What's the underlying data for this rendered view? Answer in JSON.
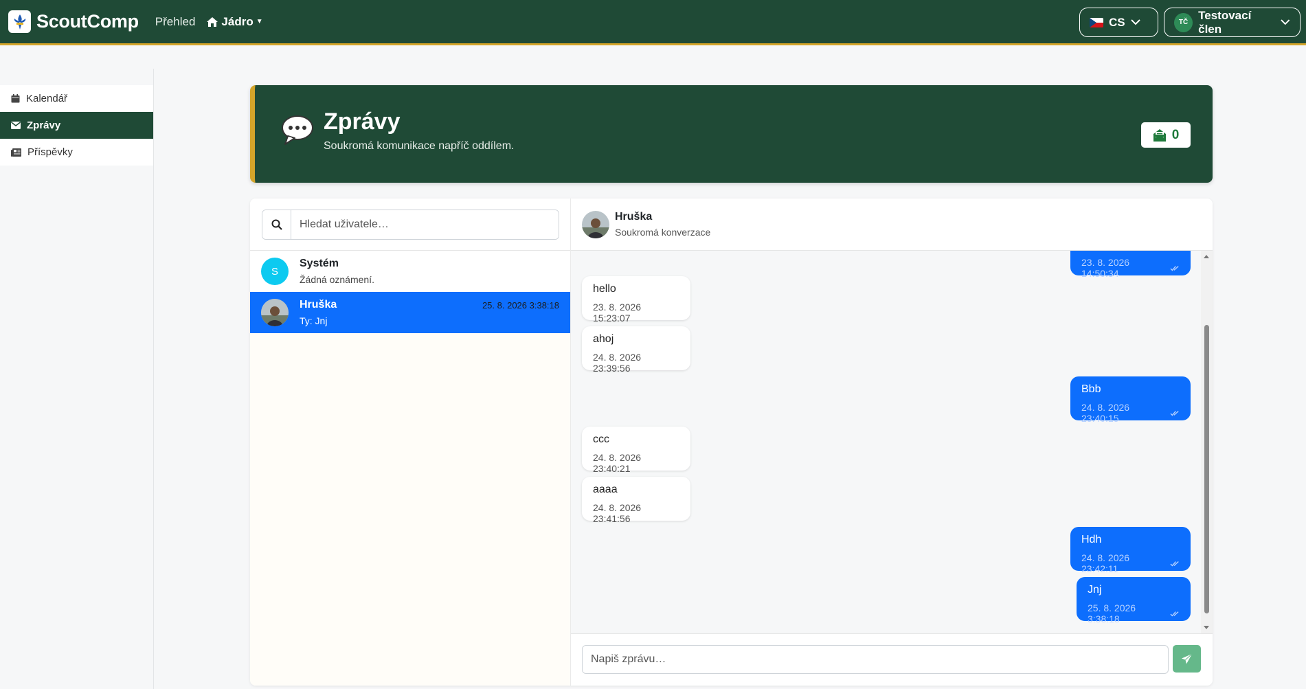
{
  "navbar": {
    "brand": "ScoutComp",
    "overview_link": "Přehled",
    "core_menu": "Jádro",
    "language": "CS",
    "user_initials": "TČ",
    "user_name": "Testovací člen"
  },
  "sidebar": {
    "items": [
      {
        "label": "Kalendář",
        "icon": "calendar-icon",
        "active": false
      },
      {
        "label": "Zprávy",
        "icon": "envelope-icon",
        "active": true
      },
      {
        "label": "Příspěvky",
        "icon": "newspaper-icon",
        "active": false
      }
    ]
  },
  "header": {
    "title": "Zprávy",
    "subtitle": "Soukromá komunikace napříč oddílem.",
    "unread_count": "0"
  },
  "conversations": {
    "search_placeholder": "Hledat uživatele…",
    "items": [
      {
        "name": "Systém",
        "avatar_letter": "S",
        "preview": "Žádná oznámení.",
        "time": "",
        "active": false
      },
      {
        "name": "Hruška",
        "avatar_letter": "",
        "preview": "Ty: Jnj",
        "time": "25. 8. 2026 3:38:18",
        "active": true
      }
    ]
  },
  "chat": {
    "name": "Hruška",
    "subtitle": "Soukromá konverzace",
    "messages": [
      {
        "dir": "out",
        "text": "",
        "time": "23. 8. 2026 14:50:34"
      },
      {
        "dir": "in",
        "text": "hello",
        "time": "23. 8. 2026 15:23:07"
      },
      {
        "dir": "in",
        "text": "ahoj",
        "time": "24. 8. 2026 23:39:56"
      },
      {
        "dir": "out",
        "text": "Bbb",
        "time": "24. 8. 2026 23:40:15"
      },
      {
        "dir": "in",
        "text": "ccc",
        "time": "24. 8. 2026 23:40:21"
      },
      {
        "dir": "in",
        "text": "aaaa",
        "time": "24. 8. 2026 23:41:56"
      },
      {
        "dir": "out",
        "text": "Hdh",
        "time": "24. 8. 2026 23:42:11"
      },
      {
        "dir": "out",
        "text": "Jnj",
        "time": "25. 8. 2026 3:38:18"
      }
    ],
    "composer_placeholder": "Napiš zprávu…"
  },
  "colors": {
    "primary_green": "#1f4a36",
    "accent_gold": "#d4a52a",
    "active_blue": "#0d6efd",
    "send_green": "#65b88a"
  }
}
